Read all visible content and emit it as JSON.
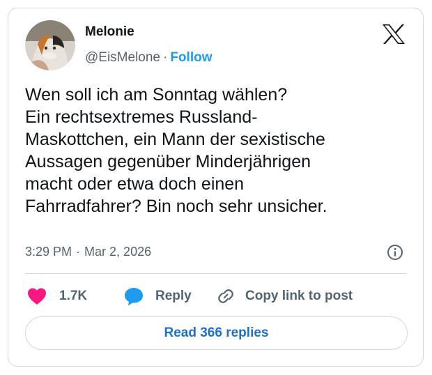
{
  "author": {
    "name": "Melonie",
    "handle": "@EisMelone",
    "separator": "·",
    "follow_label": "Follow"
  },
  "tweet": {
    "lines": [
      "Wen soll ich am Sonntag wählen?",
      "Ein rechtsextremes Russland-",
      "Maskottchen, ein Mann der sexistische",
      "Aussagen gegenüber Minderjährigen",
      "macht oder etwa doch einen",
      "Fahrradfahrer? Bin noch sehr unsicher."
    ],
    "time": "3:29 PM",
    "separator": "·",
    "date": "Mar 2, 2026"
  },
  "actions": {
    "likes": "1.7K",
    "reply_label": "Reply",
    "copy_label": "Copy link to post"
  },
  "read_replies_label": "Read 366 replies",
  "icons": {
    "like": "heart-icon",
    "reply": "speech-bubble-icon",
    "copy": "link-icon",
    "info": "info-icon",
    "brand": "x-logo-icon"
  },
  "colors": {
    "like": "#f91880",
    "reply": "#1d9bf0",
    "link_text": "#1d70c9",
    "secondary_text": "#536471",
    "border": "#cfd9de"
  }
}
